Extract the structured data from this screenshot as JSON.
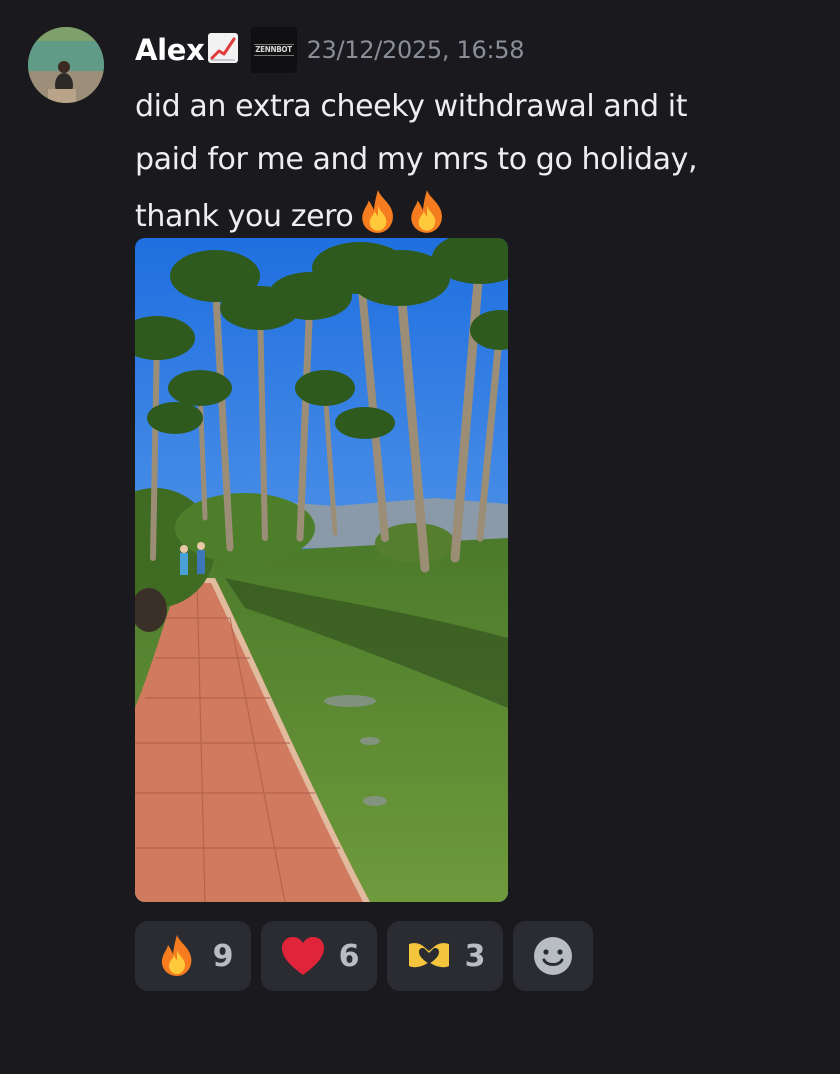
{
  "message": {
    "author": "Alex",
    "author_icon": "chart-increasing-emoji",
    "role_badge": "ZENNBOT",
    "timestamp": "23/12/2025, 16:58",
    "text_lines": [
      "did an extra cheeky withdrawal and it",
      "paid for me and my mrs to go holiday,",
      "thank you zero"
    ],
    "trailing_emojis": [
      "fire",
      "fire"
    ],
    "attachment": {
      "type": "image",
      "subject": "palm-tree garden with tiled path"
    }
  },
  "reactions": [
    {
      "emoji": "fire",
      "count": "9"
    },
    {
      "emoji": "red-heart",
      "count": "6"
    },
    {
      "emoji": "heart-hands",
      "count": "3"
    }
  ],
  "add_reaction": {
    "icon": "smiley-add-reaction-icon"
  },
  "colors": {
    "background": "#1a1a1e",
    "reaction_bg": "#2b2c31",
    "username": "#ffffff",
    "timestamp": "#8a8e96",
    "text": "#eceef0"
  }
}
